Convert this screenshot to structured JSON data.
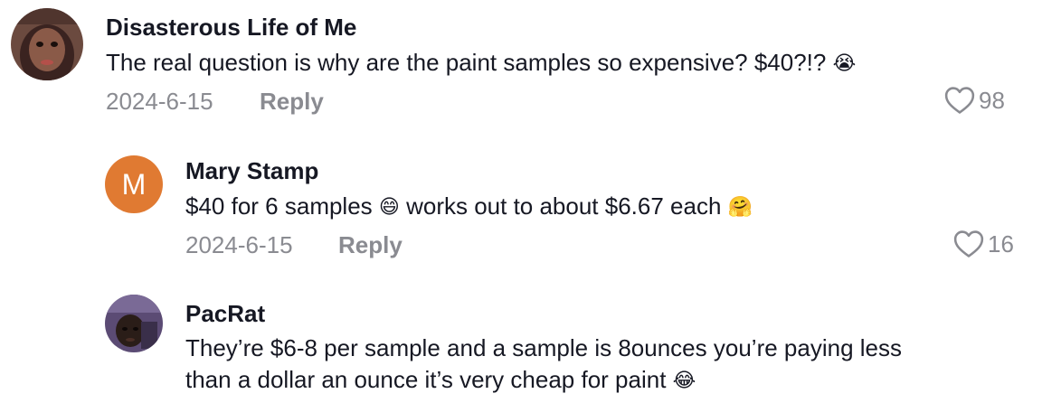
{
  "comments": [
    {
      "username": "Disasterous Life of Me",
      "text": "The real question is why are the paint samples so expensive? $40?!?",
      "emoji": "😭",
      "date": "2024-6-15",
      "reply_label": "Reply",
      "likes": "98",
      "avatar": "photo"
    },
    {
      "username": "Mary Stamp",
      "text_part1": "$40 for 6 samples",
      "emoji1": "😄",
      "text_part2": "works out to about $6.67 each",
      "emoji2": "🤗",
      "date": "2024-6-15",
      "reply_label": "Reply",
      "likes": "16",
      "avatar_initial": "M",
      "avatar_color": "#e07a32"
    },
    {
      "username": "PacRat",
      "text_line1": "They’re $6-8 per sample and a sample is 8ounces you’re paying less",
      "text_line2": "than a dollar an ounce it’s very cheap for paint",
      "emoji": "😂",
      "avatar": "photo"
    }
  ],
  "icons": {
    "like": "heart-outline-icon"
  },
  "colors": {
    "text": "#161823",
    "secondary": "#8a8b91",
    "avatar_m": "#e07a32"
  }
}
